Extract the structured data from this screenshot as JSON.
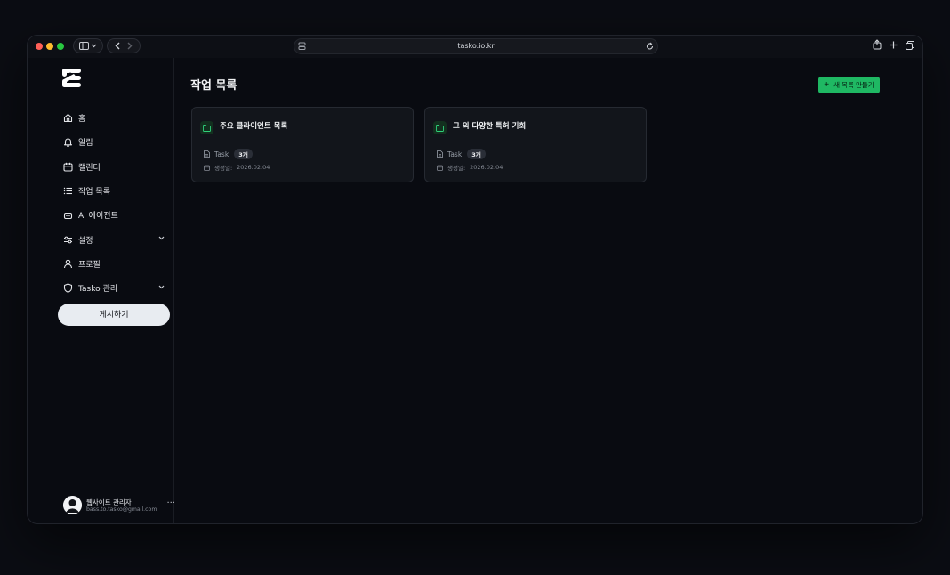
{
  "browser": {
    "url": "tasko.io.kr"
  },
  "sidebar": {
    "items": [
      {
        "label": "홈",
        "icon": "home-icon"
      },
      {
        "label": "알림",
        "icon": "bell-icon"
      },
      {
        "label": "캘린더",
        "icon": "calendar-icon"
      },
      {
        "label": "작업 목록",
        "icon": "list-icon"
      },
      {
        "label": "AI 에이전트",
        "icon": "robot-icon"
      },
      {
        "label": "설정",
        "icon": "sliders-icon",
        "expandable": true
      },
      {
        "label": "프로필",
        "icon": "user-icon"
      },
      {
        "label": "Tasko 관리",
        "icon": "shield-icon",
        "expandable": true
      }
    ],
    "publish_label": "게시하기",
    "user": {
      "name": "웹사이트 관리자",
      "email": "bass.to.tasko@gmail.com"
    }
  },
  "main": {
    "title": "작업 목록",
    "new_button_label": "새 목록 만들기",
    "cards": [
      {
        "title": "주요 클라이언트 목록",
        "task_label": "Task",
        "count": "3개",
        "created_label": "생성일:",
        "created_date": "2026.02.04"
      },
      {
        "title": "그 외 다양한 특허 기회",
        "task_label": "Task",
        "count": "3개",
        "created_label": "생성일:",
        "created_date": "2026.02.04"
      }
    ]
  },
  "colors": {
    "accent": "#1fb863",
    "background": "#090b11",
    "card": "#12151b"
  }
}
